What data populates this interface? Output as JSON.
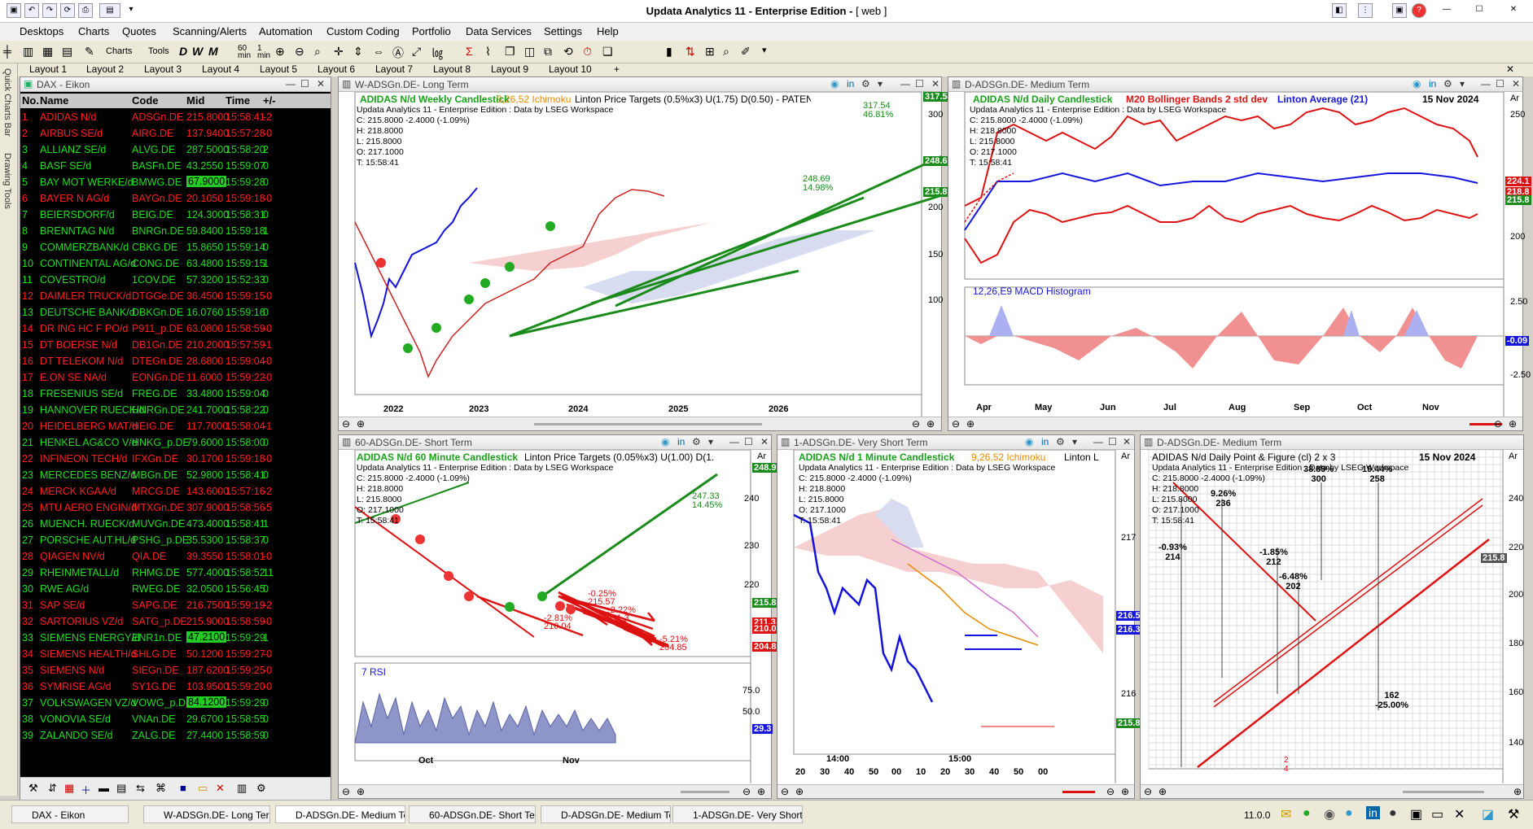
{
  "app": {
    "title": "Updata Analytics 11 - Enterprise Edition -",
    "title_suffix": "[ web ]"
  },
  "menu": [
    "Desktops",
    "Charts",
    "Quotes",
    "Scanning/Alerts",
    "Automation",
    "Custom Coding",
    "Portfolio",
    "Data Services",
    "Settings",
    "Help"
  ],
  "toolbar": {
    "charts": "Charts",
    "tools": "Tools",
    "min60": "60\nmin",
    "min1": "1\nmin"
  },
  "layouts": [
    "Layout 1",
    "Layout 2",
    "Layout 3",
    "Layout 4",
    "Layout 5",
    "Layout 6",
    "Layout 7",
    "Layout 8",
    "Layout 9",
    "Layout 10",
    "+"
  ],
  "sidebar": {
    "quick_charts": "Quick Charts Bar",
    "drawing_tools": "Drawing Tools"
  },
  "quotes": {
    "window_title": "DAX - Eikon",
    "columns": [
      "No.",
      "Name",
      "Code",
      "Mid",
      "Time",
      "+/-"
    ],
    "rows": [
      {
        "no": "1",
        "name": "ADIDAS N/d",
        "code": "ADSGn.DE",
        "mid": "215.8000",
        "time": "15:58:41",
        "chg": "-2",
        "color": "#ff2020",
        "hl": ""
      },
      {
        "no": "2",
        "name": "AIRBUS SE/d",
        "code": "AIRG.DE",
        "mid": "137.9400",
        "time": "15:57:28",
        "chg": "-0",
        "color": "#ff2020",
        "hl": ""
      },
      {
        "no": "3",
        "name": "ALLIANZ SE/d",
        "code": "ALVG.DE",
        "mid": "287.5000",
        "time": "15:58:20",
        "chg": "2",
        "color": "#22dd22",
        "hl": ""
      },
      {
        "no": "4",
        "name": "BASF SE/d",
        "code": "BASFn.DE",
        "mid": "43.2550",
        "time": "15:59:07",
        "chg": "0",
        "color": "#22dd22",
        "hl": ""
      },
      {
        "no": "5",
        "name": "BAY MOT WERKE/d",
        "code": "BMWG.DE",
        "mid": "67.9000",
        "time": "15:59:28",
        "chg": "0",
        "color": "#22dd22",
        "hl": "#22cc22"
      },
      {
        "no": "6",
        "name": "BAYER N AG/d",
        "code": "BAYGn.DE",
        "mid": "20.1050",
        "time": "15:59:18",
        "chg": "-0",
        "color": "#ff2020",
        "hl": ""
      },
      {
        "no": "7",
        "name": "BEIERSDORF/d",
        "code": "BEIG.DE",
        "mid": "124.3000",
        "time": "15:58:31",
        "chg": "0",
        "color": "#22dd22",
        "hl": ""
      },
      {
        "no": "8",
        "name": "BRENNTAG N/d",
        "code": "BNRGn.DE",
        "mid": "59.8400",
        "time": "15:59:18",
        "chg": "1",
        "color": "#22dd22",
        "hl": ""
      },
      {
        "no": "9",
        "name": "COMMERZBANK/d",
        "code": "CBKG.DE",
        "mid": "15.8650",
        "time": "15:59:14",
        "chg": "0",
        "color": "#22dd22",
        "hl": ""
      },
      {
        "no": "10",
        "name": "CONTINENTAL AG/d",
        "code": "CONG.DE",
        "mid": "63.4800",
        "time": "15:59:15",
        "chg": "1",
        "color": "#22dd22",
        "hl": ""
      },
      {
        "no": "11",
        "name": "COVESTRO/d",
        "code": "1COV.DE",
        "mid": "57.3200",
        "time": "15:52:33",
        "chg": "0",
        "color": "#22dd22",
        "hl": ""
      },
      {
        "no": "12",
        "name": "DAIMLER TRUCK/d",
        "code": "DTGGe.DE",
        "mid": "36.4500",
        "time": "15:59:15",
        "chg": "-0",
        "color": "#ff2020",
        "hl": ""
      },
      {
        "no": "13",
        "name": "DEUTSCHE BANK/d",
        "code": "DBKGn.DE",
        "mid": "16.0760",
        "time": "15:59:16",
        "chg": "0",
        "color": "#22dd22",
        "hl": ""
      },
      {
        "no": "14",
        "name": "DR ING HC F PO/d",
        "code": "P911_p.DE",
        "mid": "63.0800",
        "time": "15:58:59",
        "chg": "-0",
        "color": "#ff2020",
        "hl": ""
      },
      {
        "no": "15",
        "name": "DT BOERSE N/d",
        "code": "DB1Gn.DE",
        "mid": "210.2000",
        "time": "15:57:59",
        "chg": "-1",
        "color": "#ff2020",
        "hl": ""
      },
      {
        "no": "16",
        "name": "DT TELEKOM N/d",
        "code": "DTEGn.DE",
        "mid": "28.6800",
        "time": "15:59:04",
        "chg": "-0",
        "color": "#ff2020",
        "hl": ""
      },
      {
        "no": "17",
        "name": "E.ON SE NA/d",
        "code": "EONGn.DE",
        "mid": "11.6000",
        "time": "15:59:22",
        "chg": "-0",
        "color": "#ff2020",
        "hl": ""
      },
      {
        "no": "18",
        "name": "FRESENIUS SE/d",
        "code": "FREG.DE",
        "mid": "33.4800",
        "time": "15:59:04",
        "chg": "0",
        "color": "#22dd22",
        "hl": ""
      },
      {
        "no": "19",
        "name": "HANNOVER RUECK/d",
        "code": "HNRGn.DE",
        "mid": "241.7000",
        "time": "15:58:22",
        "chg": "0",
        "color": "#22dd22",
        "hl": ""
      },
      {
        "no": "20",
        "name": "HEIDELBERG MAT/d",
        "code": "HEIG.DE",
        "mid": "117.7000",
        "time": "15:58:04",
        "chg": "-1",
        "color": "#ff2020",
        "hl": ""
      },
      {
        "no": "21",
        "name": "HENKEL AG&CO V/d",
        "code": "HNKG_p.DE",
        "mid": "79.6000",
        "time": "15:58:00",
        "chg": "0",
        "color": "#22dd22",
        "hl": ""
      },
      {
        "no": "22",
        "name": "INFINEON TECH/d",
        "code": "IFXGn.DE",
        "mid": "30.1700",
        "time": "15:59:18",
        "chg": "-0",
        "color": "#ff2020",
        "hl": ""
      },
      {
        "no": "23",
        "name": "MERCEDES BENZ/d",
        "code": "MBGn.DE",
        "mid": "52.9800",
        "time": "15:58:41",
        "chg": "0",
        "color": "#22dd22",
        "hl": ""
      },
      {
        "no": "24",
        "name": "MERCK KGAA/d",
        "code": "MRCG.DE",
        "mid": "143.6000",
        "time": "15:57:16",
        "chg": "-2",
        "color": "#ff2020",
        "hl": ""
      },
      {
        "no": "25",
        "name": "MTU AERO ENGIN/d",
        "code": "MTXGn.DE",
        "mid": "307.9000",
        "time": "15:58:56",
        "chg": "-5",
        "color": "#ff2020",
        "hl": ""
      },
      {
        "no": "26",
        "name": "MUENCH. RUECK/d",
        "code": "MUVGn.DE",
        "mid": "473.4000",
        "time": "15:58:41",
        "chg": "1",
        "color": "#22dd22",
        "hl": ""
      },
      {
        "no": "27",
        "name": "PORSCHE AUT.HL/d",
        "code": "PSHG_p.DE",
        "mid": "35.5300",
        "time": "15:58:37",
        "chg": "0",
        "color": "#22dd22",
        "hl": ""
      },
      {
        "no": "28",
        "name": "QIAGEN NV/d",
        "code": "QIA.DE",
        "mid": "39.3550",
        "time": "15:58:01",
        "chg": "-0",
        "color": "#ff2020",
        "hl": ""
      },
      {
        "no": "29",
        "name": "RHEINMETALL/d",
        "code": "RHMG.DE",
        "mid": "577.4000",
        "time": "15:58:52",
        "chg": "11",
        "color": "#22dd22",
        "hl": ""
      },
      {
        "no": "30",
        "name": "RWE AG/d",
        "code": "RWEG.DE",
        "mid": "32.0500",
        "time": "15:56:45",
        "chg": "0",
        "color": "#22dd22",
        "hl": ""
      },
      {
        "no": "31",
        "name": "SAP SE/d",
        "code": "SAPG.DE",
        "mid": "216.7500",
        "time": "15:59:19",
        "chg": "-2",
        "color": "#ff2020",
        "hl": ""
      },
      {
        "no": "32",
        "name": "SARTORIUS VZ/d",
        "code": "SATG_p.DE",
        "mid": "215.9000",
        "time": "15:58:59",
        "chg": "-0",
        "color": "#ff2020",
        "hl": ""
      },
      {
        "no": "33",
        "name": "SIEMENS ENERGY/d",
        "code": "ENR1n.DE",
        "mid": "47.2100",
        "time": "15:59:29",
        "chg": "1",
        "color": "#22dd22",
        "hl": "#22cc22"
      },
      {
        "no": "34",
        "name": "SIEMENS HEALTH/d",
        "code": "SHLG.DE",
        "mid": "50.1200",
        "time": "15:59:27",
        "chg": "-0",
        "color": "#ff2020",
        "hl": ""
      },
      {
        "no": "35",
        "name": "SIEMENS N/d",
        "code": "SIEGn.DE",
        "mid": "187.6200",
        "time": "15:59:25",
        "chg": "-0",
        "color": "#ff2020",
        "hl": ""
      },
      {
        "no": "36",
        "name": "SYMRISE AG/d",
        "code": "SY1G.DE",
        "mid": "103.9500",
        "time": "15:59:20",
        "chg": "-0",
        "color": "#ff2020",
        "hl": ""
      },
      {
        "no": "37",
        "name": "VOLKSWAGEN VZ/d",
        "code": "VOWG_p.DE",
        "mid": "84.1200",
        "time": "15:59:29",
        "chg": "0",
        "color": "#22dd22",
        "hl": "#22cc22"
      },
      {
        "no": "38",
        "name": "VONOVIA SE/d",
        "code": "VNAn.DE",
        "mid": "29.6700",
        "time": "15:58:55",
        "chg": "0",
        "color": "#22dd22",
        "hl": ""
      },
      {
        "no": "39",
        "name": "ZALANDO SE/d",
        "code": "ZALG.DE",
        "mid": "27.4400",
        "time": "15:58:59",
        "chg": "0",
        "color": "#22dd22",
        "hl": ""
      }
    ]
  },
  "info": {
    "line1": "Updata Analytics 11 - Enterprise Edition : Data by LSEG Workspace",
    "c": "C: 215.8000 -2.4000 (-1.09%)",
    "h": "H: 218.8000",
    "l": "L: 215.8000",
    "o": "O: 217.1000",
    "t": "T: 15:58:41",
    "ar": "Ar"
  },
  "w_long": {
    "title": "W-ADSGn.DE- Long Term",
    "leg1": "ADIDAS N/d Weekly Candlestick",
    "leg2": "9,26,52 Ichimoku",
    "leg3": "Linton Price Targets (0.5%x3) U(1.75) D(0.50) - PATENT PEND",
    "yticks": [
      "300",
      "250",
      "200",
      "150",
      "100"
    ],
    "xticks": [
      "2022",
      "2023",
      "2024",
      "2025",
      "2026"
    ],
    "t1": "317.54",
    "t1p": "46.81%",
    "t2": "248.69",
    "t2p": "14.98%",
    "tag1": "317.54",
    "tag2": "248.69",
    "tag3": "215.8"
  },
  "d_med": {
    "title": "D-ADSGn.DE- Medium Term",
    "leg1": "ADIDAS N/d Daily Candlestick",
    "leg2": "M20 Bollinger Bands 2 std dev",
    "leg3": "Linton Average (21)",
    "date": "15 Nov 2024",
    "yticks": [
      "250",
      "200"
    ],
    "tag1": "224.1",
    "tag2": "218.8",
    "tag3": "215.8",
    "macd_title": "12,26,E9 MACD Histogram",
    "macd_ticks": [
      "2.50",
      "-2.50"
    ],
    "macd_tag": "-0.09",
    "xticks": [
      "Apr",
      "May",
      "Jun",
      "Jul",
      "Aug",
      "Sep",
      "Oct",
      "Nov"
    ]
  },
  "m60": {
    "title": "60-ADSGn.DE- Short Term",
    "leg1": "ADIDAS N/d 60 Minute Candlestick",
    "leg2": "Linton Price Targets (0.05%x3) U(1.00) D(1.",
    "yticks": [
      "240",
      "230",
      "220"
    ],
    "t_up": "247.33",
    "t_upp": "14.45%",
    "t_d1p": "-0.25%",
    "t_d1": "215.57",
    "t_d2p": "-2.22%",
    "t_d2": "211.3",
    "t_d3p": "-2.81%",
    "t_d3": "210.04",
    "t_d4p": "-5.21%",
    "t_d4": "204.85",
    "tag1": "248.9",
    "tag2": "215.8",
    "tag3": "211.3",
    "tag4": "210.0",
    "tag5": "204.8",
    "rsi_title": "7 RSI",
    "rsi_ticks": [
      "75.0",
      "50.0"
    ],
    "rsi_tag": "29.3",
    "xticks": [
      "Oct",
      "Nov"
    ]
  },
  "m1": {
    "title": "1-ADSGn.DE- Very Short Term",
    "leg1": "ADIDAS N/d 1 Minute Candlestick",
    "leg2": "9,26,52 Ichimoku",
    "leg3": "Linton L",
    "yticks": [
      "217",
      "216"
    ],
    "tag1": "216.5",
    "tag2": "216.39",
    "tag3": "215.8",
    "xmajor": [
      "14:00",
      "15:00"
    ],
    "xticks": [
      "20",
      "30",
      "40",
      "50",
      "00",
      "10",
      "20",
      "30",
      "40",
      "50",
      "00"
    ]
  },
  "pf": {
    "title": "D-ADSGn.DE- Medium Term",
    "leg1": "ADIDAS N/d Daily Point & Figure (cl) 2 x 3",
    "date": "15 Nov 2024",
    "yticks": [
      "240",
      "220",
      "200",
      "180",
      "160",
      "140"
    ],
    "tag": "215.8",
    "l1p": "-0.93%",
    "l1": "214",
    "l2p": "9.26%",
    "l2": "236",
    "l3p": "38.89%",
    "l3": "300",
    "l4p": "19.44%",
    "l4": "258",
    "l5p": "-1.85%",
    "l5": "212",
    "l6p": "-6.48%",
    "l6": "202",
    "l7": "162",
    "l7p": "-25.00%",
    "m1": "2",
    "m2": "4"
  },
  "status": {
    "version": "11.0.0"
  },
  "taskbar": [
    "DAX - Eikon",
    "W-ADSGn.DE- Long Term",
    "D-ADSGn.DE- Medium Term",
    "60-ADSGn.DE- Short Term",
    "D-ADSGn.DE- Medium Term",
    "1-ADSGn.DE- Very Short Te"
  ]
}
